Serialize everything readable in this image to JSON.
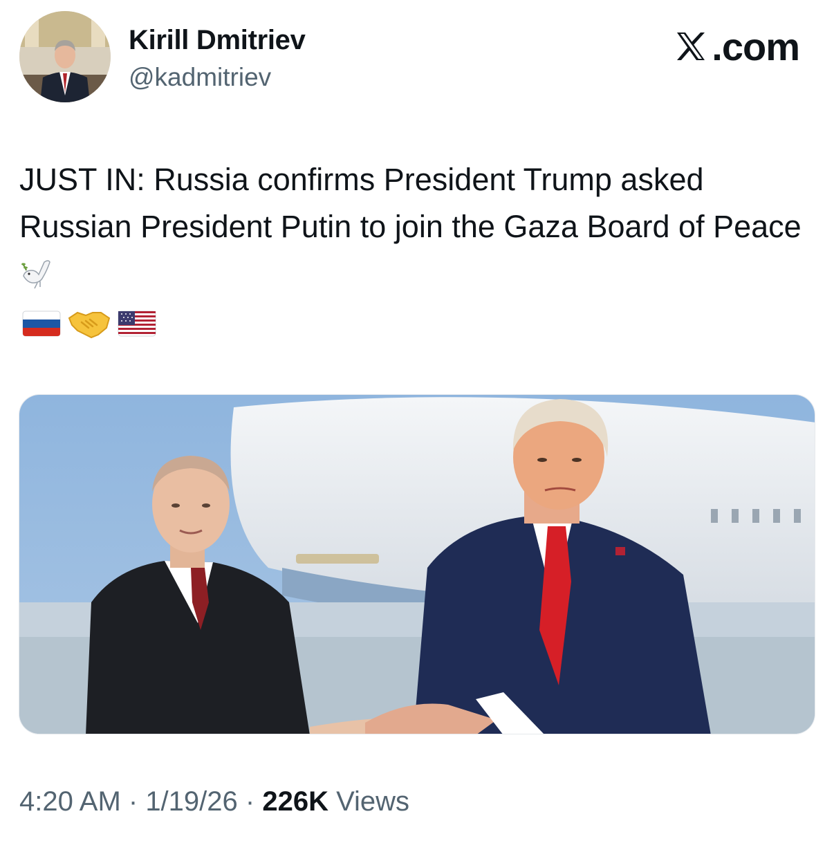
{
  "author": {
    "display_name": "Kirill Dmitriev",
    "handle": "@kadmitriev"
  },
  "brand": {
    "text": ".com",
    "icon": "x-logo-icon"
  },
  "tweet": {
    "text": "JUST IN: Russia confirms President Trump asked Russian President Putin to join the Gaza Board of Peace",
    "emojis": {
      "dove": "dove-emoji",
      "row": [
        "russia-flag-emoji",
        "handshake-emoji",
        "usa-flag-emoji"
      ]
    }
  },
  "meta": {
    "time": "4:20 AM",
    "sep1": " · ",
    "date": "1/19/26",
    "sep2": " · ",
    "views_count": "226K",
    "views_label": " Views"
  },
  "colors": {
    "text": "#0f1419",
    "secondary": "#536471",
    "russia_white": "#ffffff",
    "russia_blue": "#1c57a5",
    "russia_red": "#d52b1e",
    "handshake": "#f6c33c",
    "us_red": "#b22234",
    "us_blue": "#3c3b6e"
  }
}
